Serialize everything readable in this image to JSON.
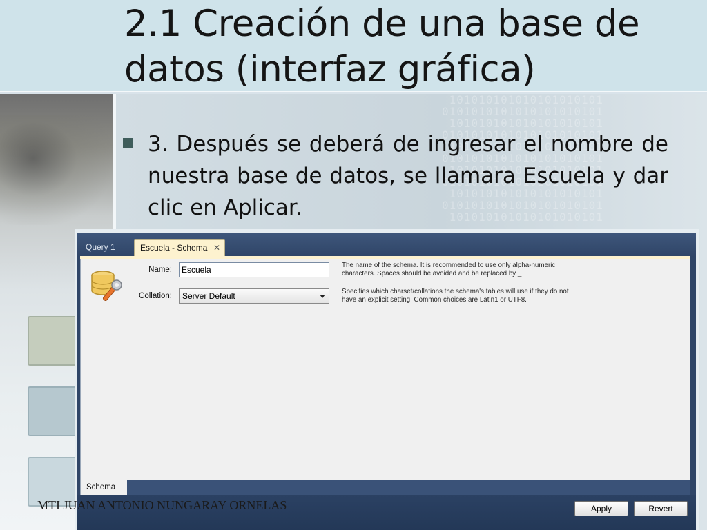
{
  "slide": {
    "title": "2.1 Creación de una base de datos (interfaz gráfica)",
    "bullet": "3. Después se deberá de ingresar el nombre de nuestra base de datos, se llamara Escuela y dar clic en Aplicar.",
    "footer": "MTI JUAN ANTONIO NUNGARAY ORNELAS"
  },
  "app": {
    "tabs": [
      {
        "label": "Query 1"
      },
      {
        "label": "Escuela - Schema"
      }
    ],
    "close_glyph": "✕",
    "form": {
      "name_label": "Name:",
      "name_value": "Escuela",
      "collation_label": "Collation:",
      "collation_value": "Server Default",
      "name_hint": "The name of the schema. It is recommended to use only alpha-numeric characters. Spaces should be avoided and be replaced by _",
      "collation_hint": "Specifies which charset/collations the schema's tables will use if they do not have an explicit setting. Common choices are Latin1 or UTF8."
    },
    "bottom_tab": "Schema",
    "buttons": {
      "apply": "Apply",
      "revert": "Revert"
    },
    "icon": "database-schema-icon"
  },
  "colors": {
    "title_band": "#cfe3ea",
    "bullet": "#3f5d5b",
    "app_chrome": "#2f4567",
    "active_tab": "#fdf2cf"
  }
}
